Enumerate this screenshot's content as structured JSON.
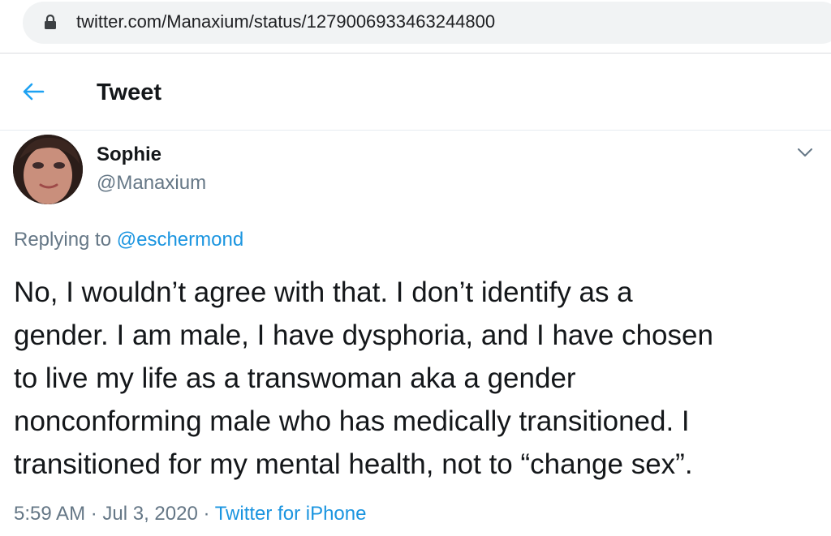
{
  "browser": {
    "url": "twitter.com/Manaxium/status/1279006933463244800"
  },
  "header": {
    "title": "Tweet"
  },
  "author": {
    "name": "Sophie",
    "handle": "@Manaxium"
  },
  "reply": {
    "prefix": "Replying to ",
    "to": "@eschermond"
  },
  "tweet": {
    "text": "No, I wouldn’t agree with that. I don’t identify as a\ngender. I am male, I have dysphoria, and I have chosen\nto live my life as a transwoman aka a gender\nnonconforming male who has medically transitioned. I\ntransitioned for my mental health, not to “change sex”."
  },
  "meta": {
    "time": "5:59 AM",
    "separator": " · ",
    "date": "Jul 3, 2020",
    "source": "Twitter for iPhone"
  },
  "colors": {
    "link": "#1b95e0",
    "secondary_text": "#657786",
    "primary_text": "#14171a"
  },
  "icons": {
    "lock": "lock-icon",
    "back": "back-arrow-icon",
    "more": "chevron-down-icon"
  }
}
